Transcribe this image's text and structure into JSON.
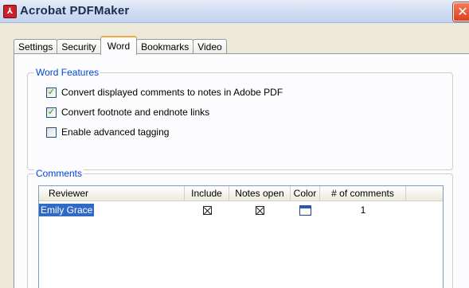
{
  "window": {
    "title": "Acrobat PDFMaker",
    "app_icon": "acrobat-icon",
    "close_icon": "close-icon",
    "close_glyph": "✕"
  },
  "tabs": [
    {
      "label": "Settings",
      "active": false
    },
    {
      "label": "Security",
      "active": false
    },
    {
      "label": "Word",
      "active": true
    },
    {
      "label": "Bookmarks",
      "active": false
    },
    {
      "label": "Video",
      "active": false
    }
  ],
  "word_features": {
    "title": "Word Features",
    "options": [
      {
        "label": "Convert displayed comments to notes in Adobe PDF",
        "checked": true
      },
      {
        "label": "Convert footnote and endnote links",
        "checked": true
      },
      {
        "label": "Enable advanced tagging",
        "checked": false
      }
    ]
  },
  "comments": {
    "title": "Comments",
    "columns": [
      "Reviewer",
      "Include",
      "Notes open",
      "Color",
      "# of comments"
    ],
    "rows": [
      {
        "reviewer": "Emily Grace",
        "include": true,
        "notes_open": true,
        "color": "#2e54b8",
        "count": "1"
      }
    ]
  },
  "colors": {
    "accent_tab": "#f5a938",
    "group_label": "#0046d5",
    "selection": "#316ac5",
    "close_button": "#d8431f"
  }
}
